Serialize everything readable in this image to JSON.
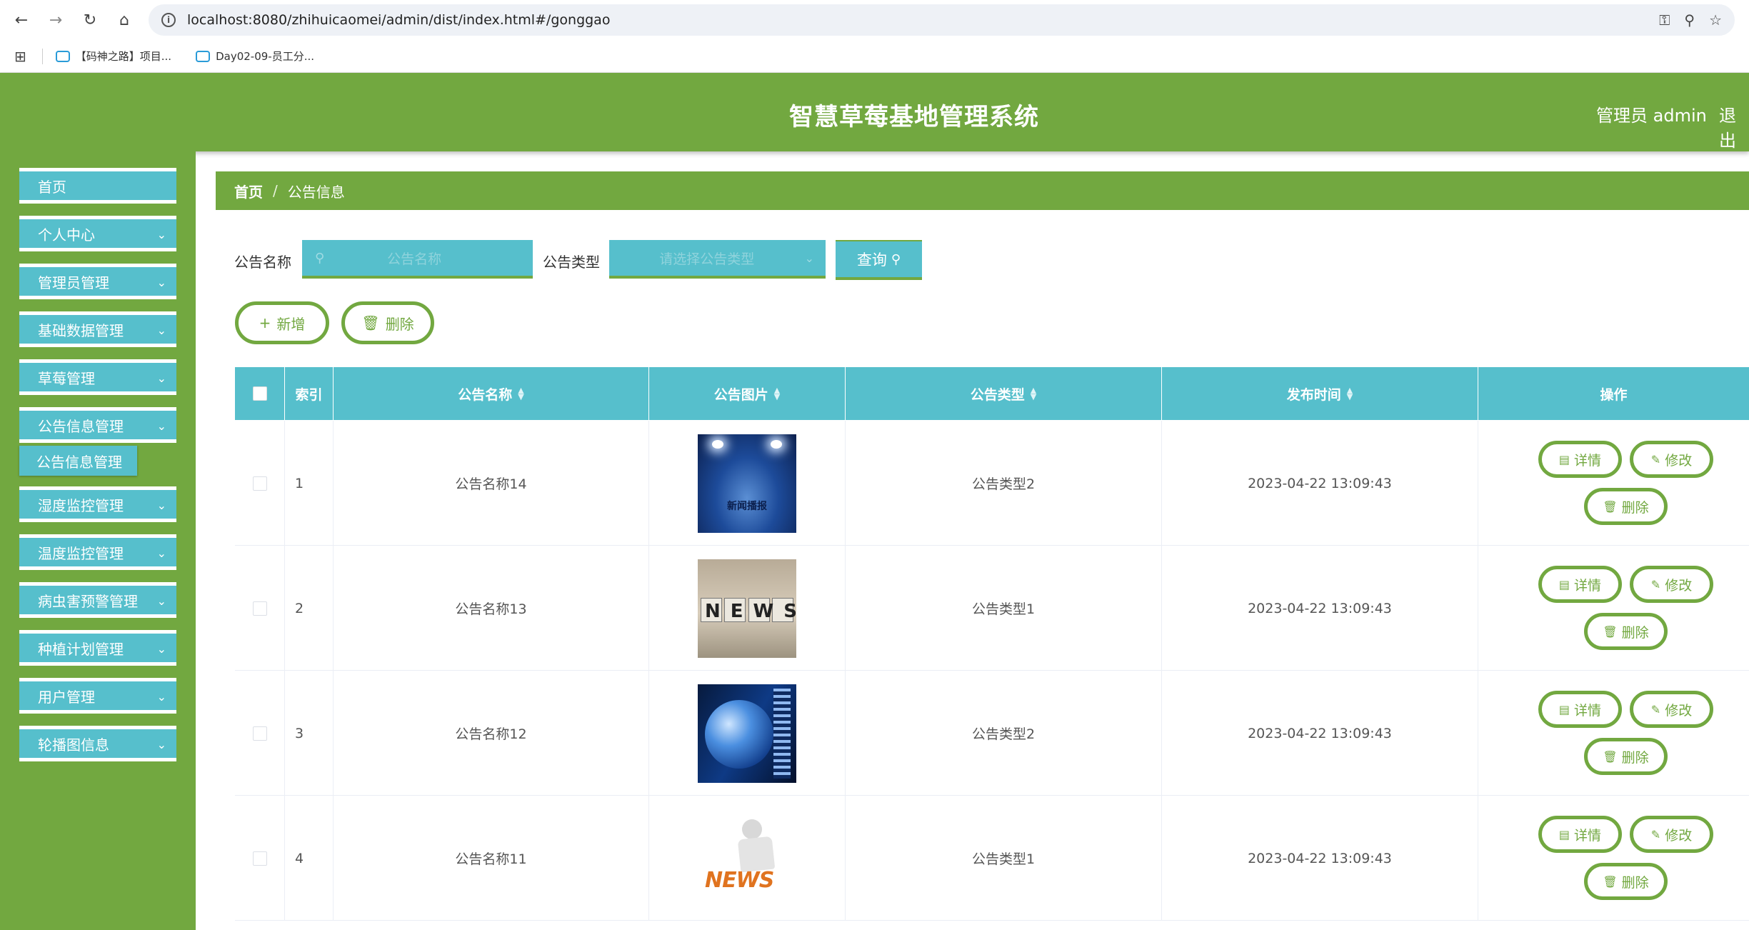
{
  "browser": {
    "url": "localhost:8080/zhihuicaomei/admin/dist/index.html#/gonggao",
    "bookmarks": [
      "【码神之路】项目...",
      "Day02-09-员工分..."
    ]
  },
  "header": {
    "title": "智慧草莓基地管理系统",
    "user": "管理员 admin",
    "logout": "退出"
  },
  "sidebar": {
    "items": [
      {
        "label": "首页"
      },
      {
        "label": "个人中心"
      },
      {
        "label": "管理员管理"
      },
      {
        "label": "基础数据管理"
      },
      {
        "label": "草莓管理"
      },
      {
        "label": "公告信息管理"
      },
      {
        "label": "湿度监控管理"
      },
      {
        "label": "温度监控管理"
      },
      {
        "label": "病虫害预警管理"
      },
      {
        "label": "种植计划管理"
      },
      {
        "label": "用户管理"
      },
      {
        "label": "轮播图信息"
      }
    ],
    "sub_item": "公告信息管理"
  },
  "breadcrumb": {
    "home": "首页",
    "sep": "/",
    "current": "公告信息"
  },
  "filters": {
    "name_label": "公告名称",
    "name_placeholder": "公告名称",
    "type_label": "公告类型",
    "type_placeholder": "请选择公告类型",
    "query_label": "查询"
  },
  "actions": {
    "add": "新增",
    "delete": "删除"
  },
  "table": {
    "headers": [
      "索引",
      "公告名称",
      "公告图片",
      "公告类型",
      "发布时间",
      "操作"
    ],
    "rows": [
      {
        "index": "1",
        "name": "公告名称14",
        "image": "news-stage-image",
        "image_text": "新闻播报",
        "type": "公告类型2",
        "time": "2023-04-22 13:09:43"
      },
      {
        "index": "2",
        "name": "公告名称13",
        "image": "news-blocks-image",
        "image_text": "NEWS",
        "type": "公告类型1",
        "time": "2023-04-22 13:09:43"
      },
      {
        "index": "3",
        "name": "公告名称12",
        "image": "globe-image",
        "image_text": "",
        "type": "公告类型2",
        "time": "2023-04-22 13:09:43"
      },
      {
        "index": "4",
        "name": "公告名称11",
        "image": "news-figure-image",
        "image_text": "NEWS",
        "type": "公告类型1",
        "time": "2023-04-22 13:09:43"
      }
    ],
    "row_actions": {
      "detail": "详情",
      "edit": "修改",
      "delete": "删除"
    }
  },
  "colors": {
    "green": "#72a840",
    "teal": "#56bfcc"
  }
}
